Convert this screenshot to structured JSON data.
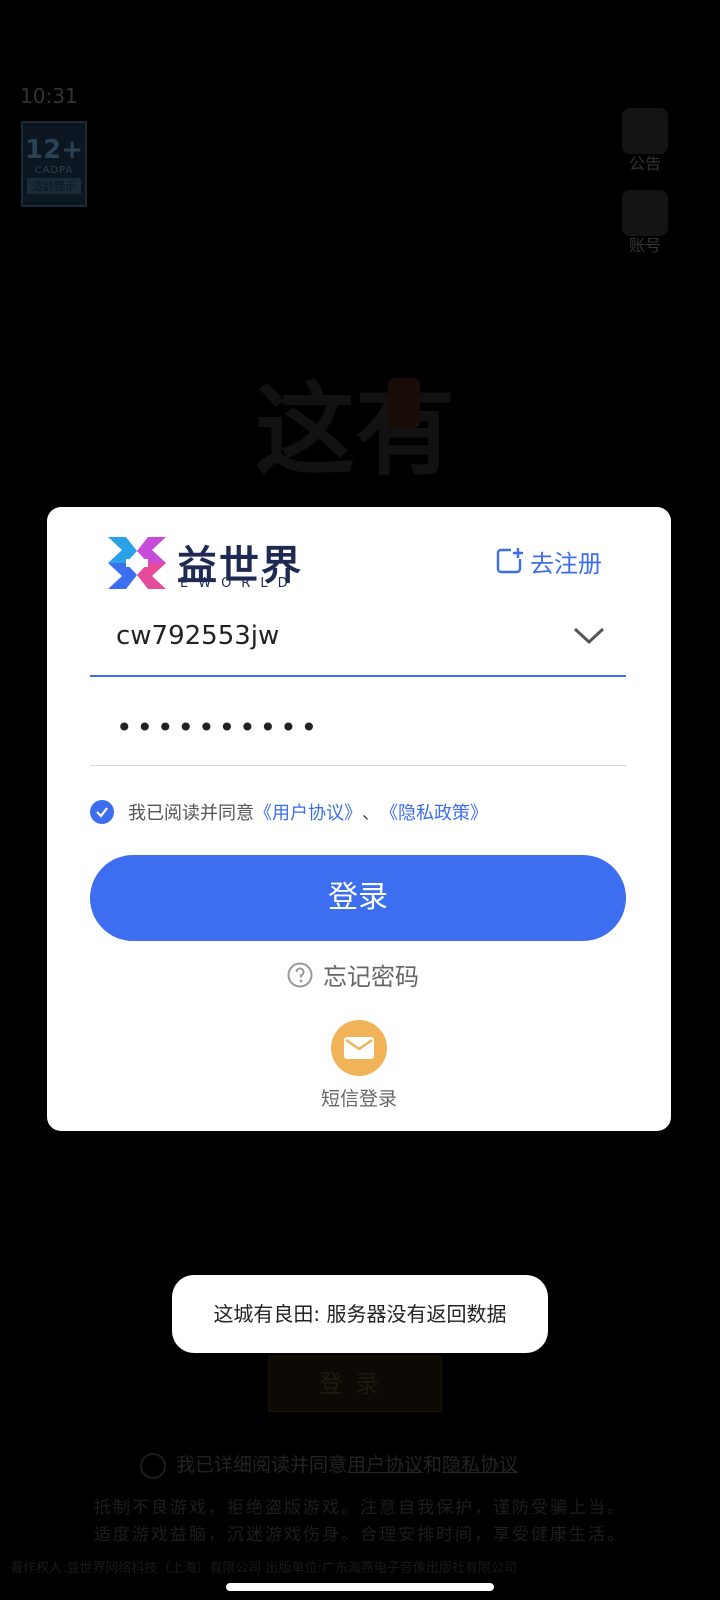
{
  "status": {
    "time": "10:31"
  },
  "age_badge": {
    "rating": "12+",
    "org": "CADPA",
    "note": "适龄提示"
  },
  "side_buttons": {
    "notice": "公告",
    "account": "账号"
  },
  "background": {
    "title_glyphs": "这有",
    "login_label": "登录",
    "agree_prefix": "我已详细阅读并同意",
    "agree_user": "用户协议",
    "agree_and": "和",
    "agree_privacy": "隐私协议",
    "notice_line1": "抵制不良游戏，拒绝盗版游戏。注意自我保护，谨防受骗上当。",
    "notice_line2": "适度游戏益脑，沉迷游戏伤身。合理安排时间，享受健康生活。",
    "footer": "著作权人:益世界网络科技（上海）有限公司    出版单位:广东海燕电子音像出版社有限公司"
  },
  "dialog": {
    "brand_cn": "益世界",
    "brand_en": "EWORLD",
    "register_label": "去注册",
    "account_value": "cw792553jw",
    "password_value": "••••••••••",
    "agree_prefix": "我已阅读并同意",
    "agree_user": "《用户协议》",
    "agree_sep": "、",
    "agree_privacy": "《隐私政策》",
    "login_label": "登录",
    "forgot_label": "忘记密码",
    "sms_label": "短信登录"
  },
  "toast": {
    "message": "这城有良田: 服务器没有返回数据"
  },
  "colors": {
    "accent": "#3d6ef0",
    "sms": "#f0b358",
    "dialog_bg": "#ffffff"
  }
}
